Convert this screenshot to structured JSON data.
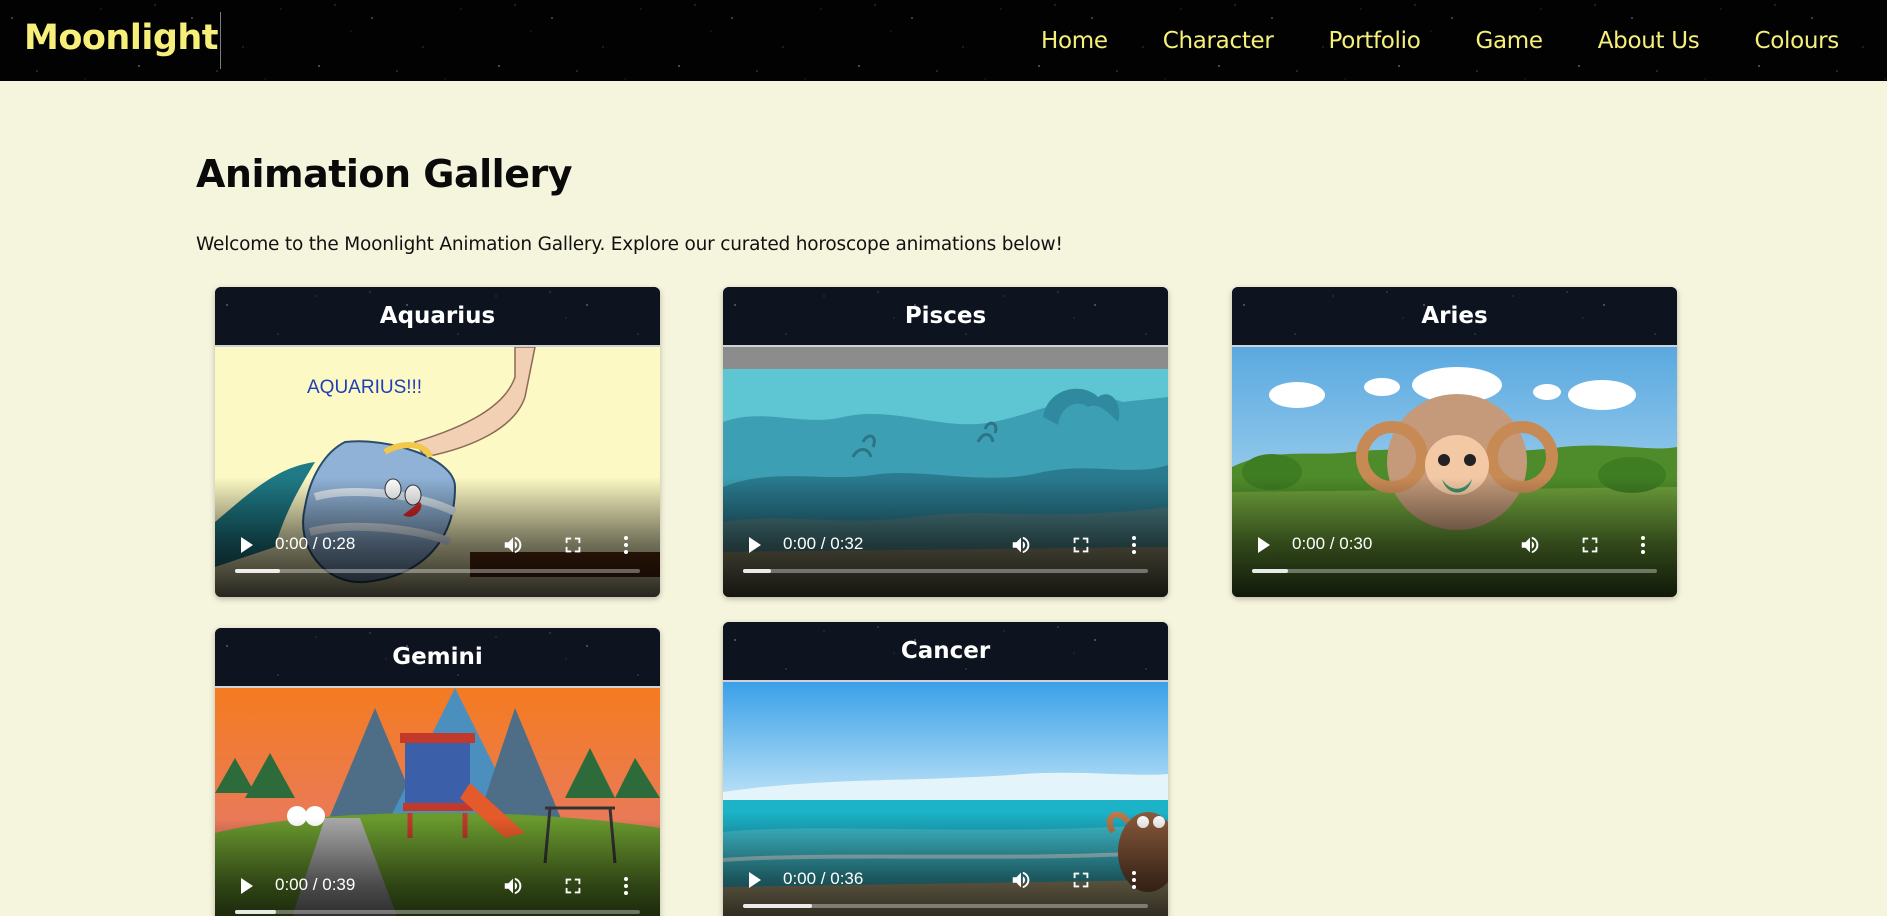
{
  "brand": {
    "name": "Moonlight"
  },
  "nav": {
    "links": [
      "Home",
      "Character",
      "Portfolio",
      "Game",
      "About Us",
      "Colours"
    ]
  },
  "main": {
    "title": "Animation Gallery",
    "intro": "Welcome to the Moonlight Animation Gallery. Explore our curated horoscope animations below!"
  },
  "gallery": {
    "cards": [
      {
        "title": "Aquarius",
        "time": "0:00 / 0:28",
        "progress": 0.11,
        "scene_text": "AQUARIUS!!!"
      },
      {
        "title": "Pisces",
        "time": "0:00 / 0:32",
        "progress": 0.07
      },
      {
        "title": "Aries",
        "time": "0:00 / 0:30",
        "progress": 0.09
      },
      {
        "title": "Gemini",
        "time": "0:00 / 0:39",
        "progress": 0.1
      },
      {
        "title": "Cancer",
        "time": "0:00 / 0:36",
        "progress": 0.17
      }
    ]
  },
  "colors": {
    "page_bg": "#f5f4dc",
    "nav_text": "#f6f07a",
    "card_header_bg": "#0d1420"
  },
  "icons": {
    "play": "play-icon",
    "volume": "volume-icon",
    "fullscreen": "fullscreen-icon",
    "more": "more-options-icon"
  }
}
